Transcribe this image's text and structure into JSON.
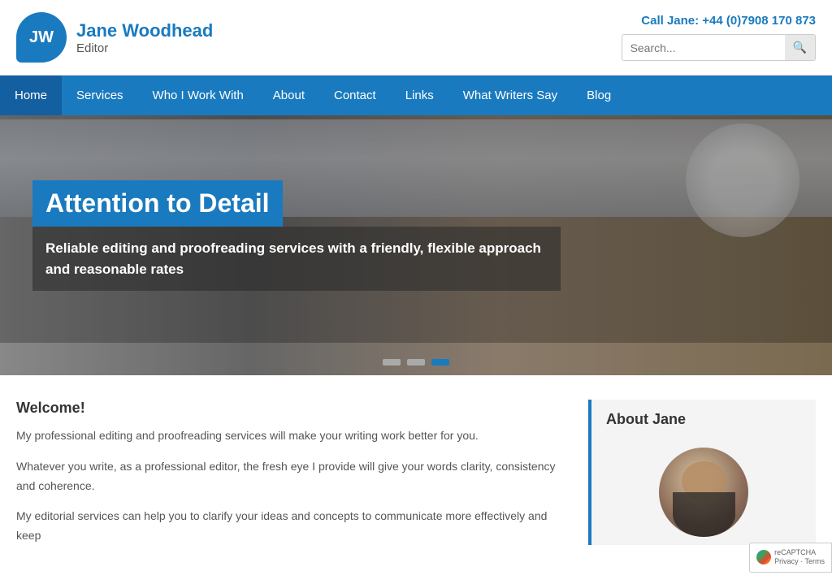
{
  "brand": {
    "initials": "JW",
    "name": "Jane Woodhead",
    "subtitle": "Editor"
  },
  "header": {
    "phone_label": "Call Jane: +44 (0)7908 170 873",
    "search_placeholder": "Search..."
  },
  "nav": {
    "items": [
      {
        "label": "Home",
        "active": true
      },
      {
        "label": "Services"
      },
      {
        "label": "Who I Work With"
      },
      {
        "label": "About"
      },
      {
        "label": "Contact"
      },
      {
        "label": "Links"
      },
      {
        "label": "What Writers Say"
      },
      {
        "label": "Blog"
      }
    ]
  },
  "hero": {
    "title": "Attention to Detail",
    "subtitle": "Reliable editing and proofreading services with a friendly, flexible approach and reasonable rates",
    "dots": [
      {
        "active": false
      },
      {
        "active": false
      },
      {
        "active": true
      }
    ]
  },
  "main": {
    "welcome_title": "Welcome!",
    "paragraphs": [
      "My professional editing and proofreading services will make your writing work better for you.",
      "Whatever you write, as a professional editor, the fresh eye I provide will give your words clarity, consistency and coherence.",
      "My editorial services can help you to clarify your ideas and concepts to communicate more effectively and keep"
    ]
  },
  "sidebar": {
    "about_jane_title": "About Jane"
  },
  "recaptcha": {
    "text": "reCAPTCHA\nPrivacy - Terms"
  }
}
